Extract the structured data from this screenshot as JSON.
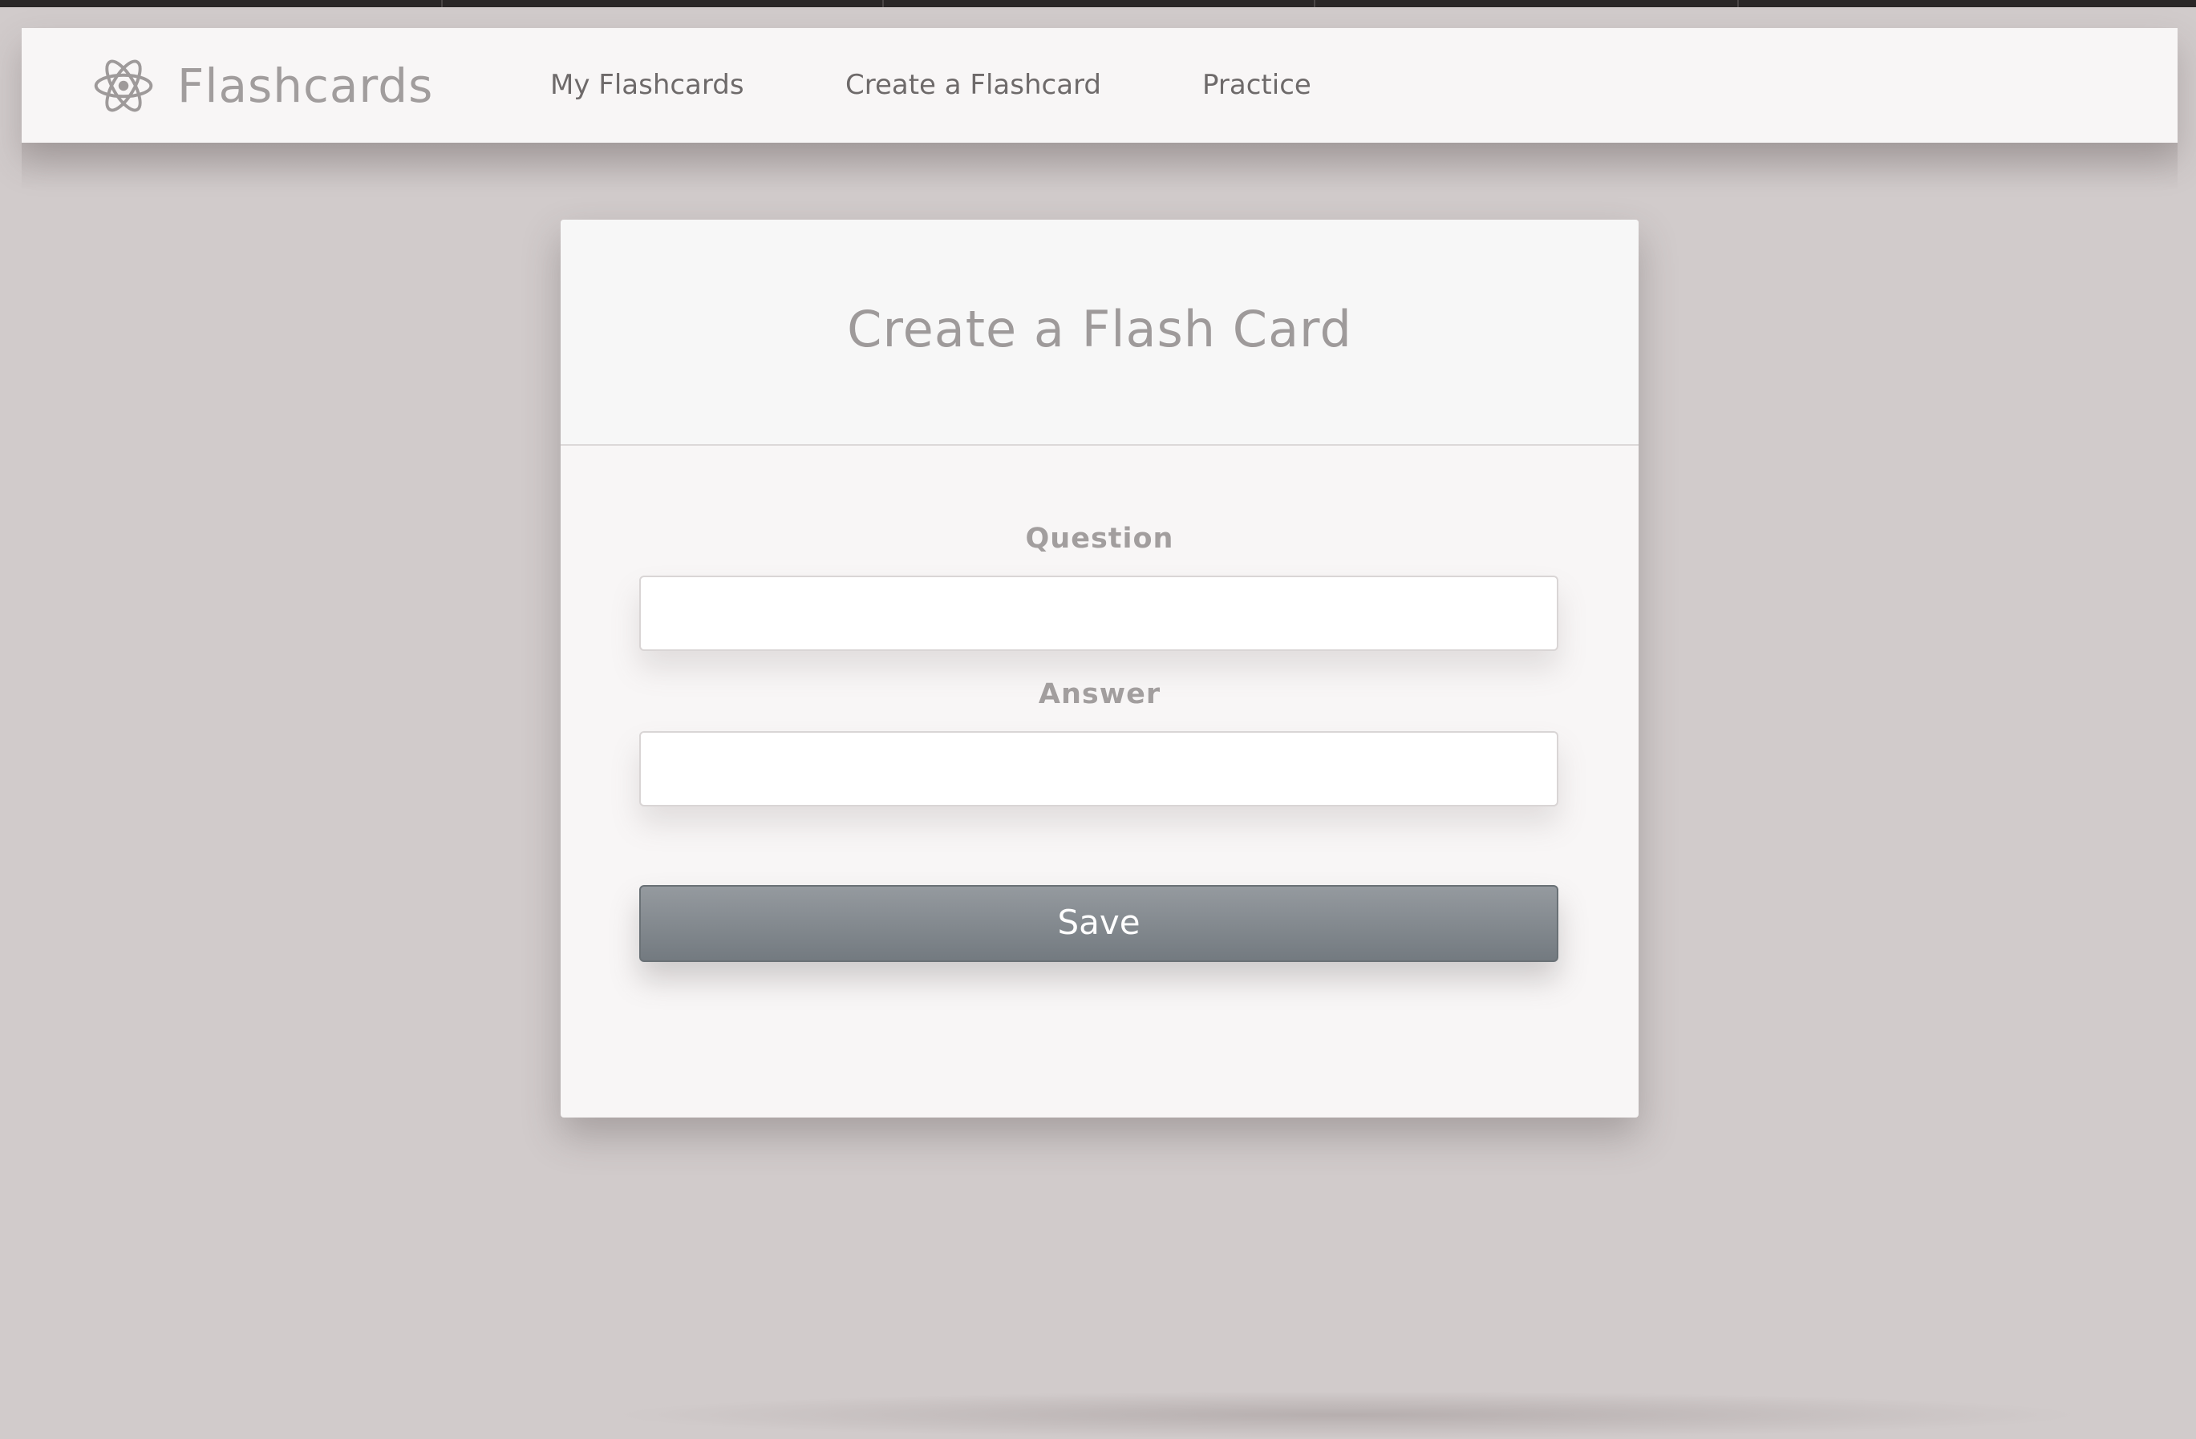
{
  "app": {
    "brand_name": "Flashcards",
    "brand_icon": "atom-icon"
  },
  "nav": {
    "links": [
      {
        "label": "My Flashcards"
      },
      {
        "label": "Create a Flashcard"
      },
      {
        "label": "Practice"
      }
    ]
  },
  "form": {
    "title": "Create a Flash Card",
    "question": {
      "label": "Question",
      "value": "",
      "placeholder": ""
    },
    "answer": {
      "label": "Answer",
      "value": "",
      "placeholder": ""
    },
    "save_label": "Save"
  },
  "colors": {
    "background": "#d1cbcb",
    "surface": "#f8f6f6",
    "button": "#7d8389",
    "muted_text": "#a19d9d"
  }
}
